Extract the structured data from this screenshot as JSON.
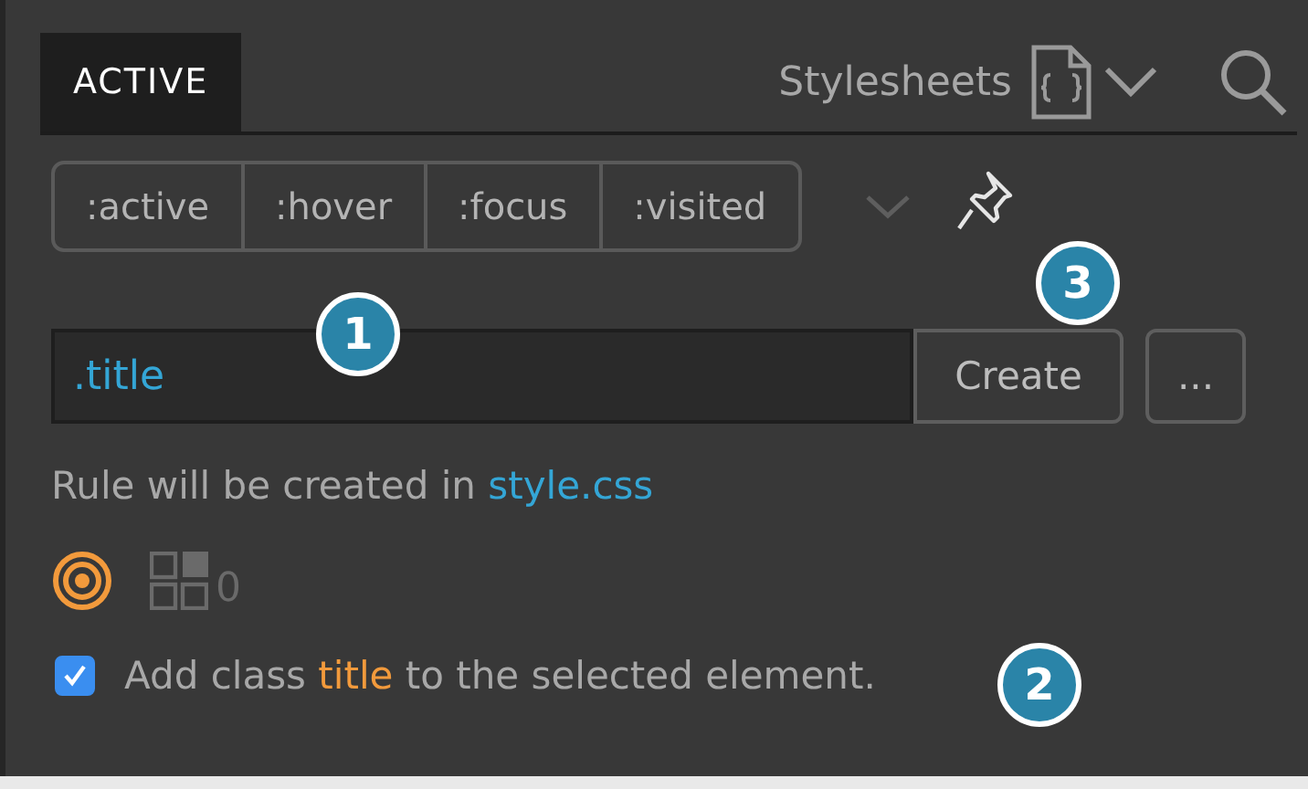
{
  "tab": {
    "label": "ACTIVE",
    "selected": true
  },
  "stylesheets": {
    "label": "Stylesheets"
  },
  "states": [
    {
      "label": ":active",
      "selected": false
    },
    {
      "label": ":hover",
      "selected": false
    },
    {
      "label": ":focus",
      "selected": false
    },
    {
      "label": ":visited",
      "selected": false
    }
  ],
  "selector": {
    "value": ".title"
  },
  "buttons": [
    {
      "label": "Create"
    },
    {
      "label": "..."
    }
  ],
  "rule_note": {
    "text": "Rule will be created in",
    "file": "style.css"
  },
  "match_count": "0",
  "add_class": {
    "checked": true,
    "before": "Add class",
    "class_name": "title",
    "after": "to the selected element."
  },
  "callouts": [
    {
      "label": "1"
    },
    {
      "label": "2"
    },
    {
      "label": "3"
    }
  ]
}
